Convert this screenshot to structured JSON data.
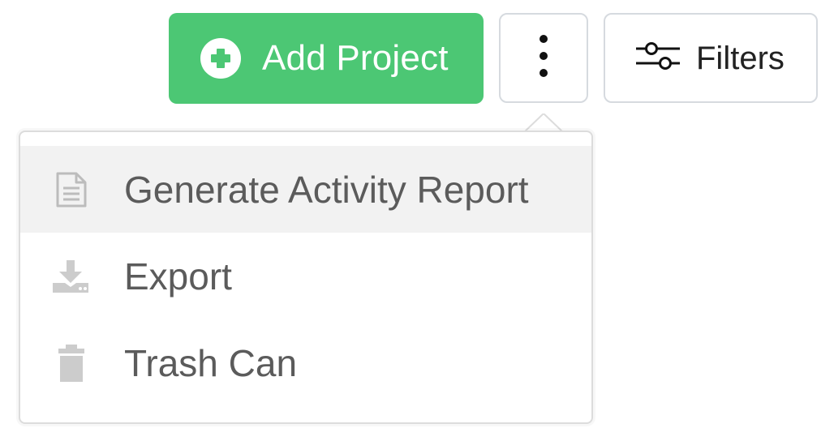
{
  "toolbar": {
    "add_project_label": "Add Project",
    "more_options_icon": "vertical-ellipsis-icon",
    "filters_label": "Filters"
  },
  "menu": {
    "items": [
      {
        "label": "Generate Activity Report",
        "icon": "document-icon",
        "active": true
      },
      {
        "label": "Export",
        "icon": "download-icon",
        "active": false
      },
      {
        "label": "Trash Can",
        "icon": "trash-icon",
        "active": false
      }
    ]
  },
  "colors": {
    "primary_green": "#4cc774",
    "menu_text": "#5b5b5b",
    "menu_icon": "#cccccc",
    "active_row": "#f2f2f2",
    "border": "#d6dadf"
  }
}
